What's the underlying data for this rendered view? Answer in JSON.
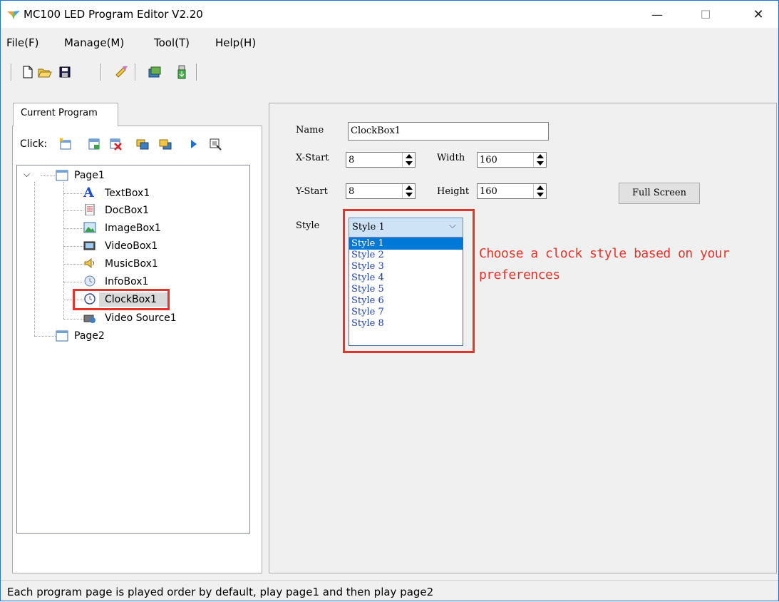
{
  "window": {
    "title": "MC100 LED Program Editor V2.20",
    "minimize": "—",
    "maximize": "☐",
    "close": "✕"
  },
  "menu": {
    "file": "File(F)",
    "manage": "Manage(M)",
    "tool": "Tool(T)",
    "help": "Help(H)"
  },
  "left_panel": {
    "tab_label": "Current Program",
    "click_label": "Click:",
    "tree": {
      "page1": "Page1",
      "children": [
        "TextBox1",
        "DocBox1",
        "ImageBox1",
        "VideoBox1",
        "MusicBox1",
        "InfoBox1",
        "ClockBox1",
        "Video Source1"
      ],
      "page2": "Page2"
    }
  },
  "properties": {
    "name_label": "Name",
    "name_value": "ClockBox1",
    "xstart_label": "X-Start",
    "xstart_value": "8",
    "ystart_label": "Y-Start",
    "ystart_value": "8",
    "width_label": "Width",
    "width_value": "160",
    "height_label": "Height",
    "height_value": "160",
    "full_screen": "Full Screen",
    "style_label": "Style",
    "style_selected": "Style 1",
    "style_options": [
      "Style 1",
      "Style 2",
      "Style 3",
      "Style 4",
      "Style 5",
      "Style 6",
      "Style 7",
      "Style 8"
    ]
  },
  "annotation": {
    "line1": "Choose a clock style based on your",
    "line2": "preferences",
    "color": "#e8332a"
  },
  "status": "Each program page is played order by default, play page1 and then play page2"
}
